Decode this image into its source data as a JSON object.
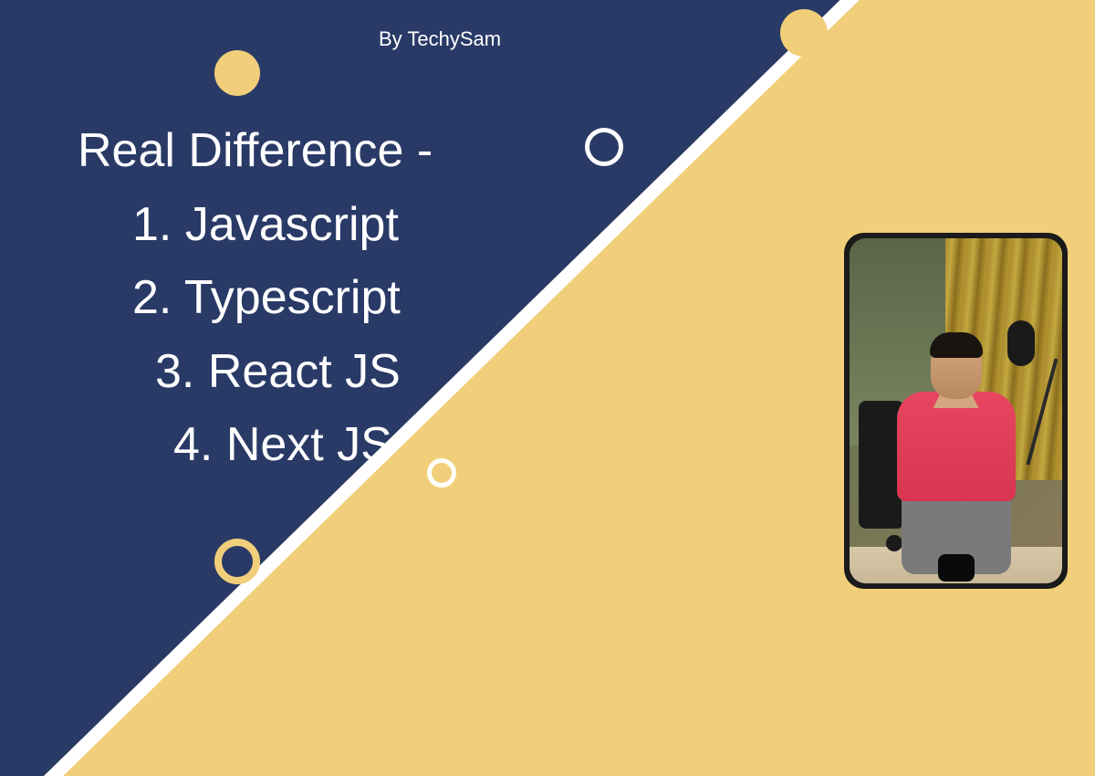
{
  "byline": "By TechySam",
  "title": "Real Difference -",
  "items": [
    "1.  Javascript",
    "2.  Typescript",
    "3.  React JS",
    "4.  Next JS"
  ],
  "colors": {
    "navy": "#293a66",
    "gold": "#f1cf7a",
    "white": "#ffffff"
  }
}
